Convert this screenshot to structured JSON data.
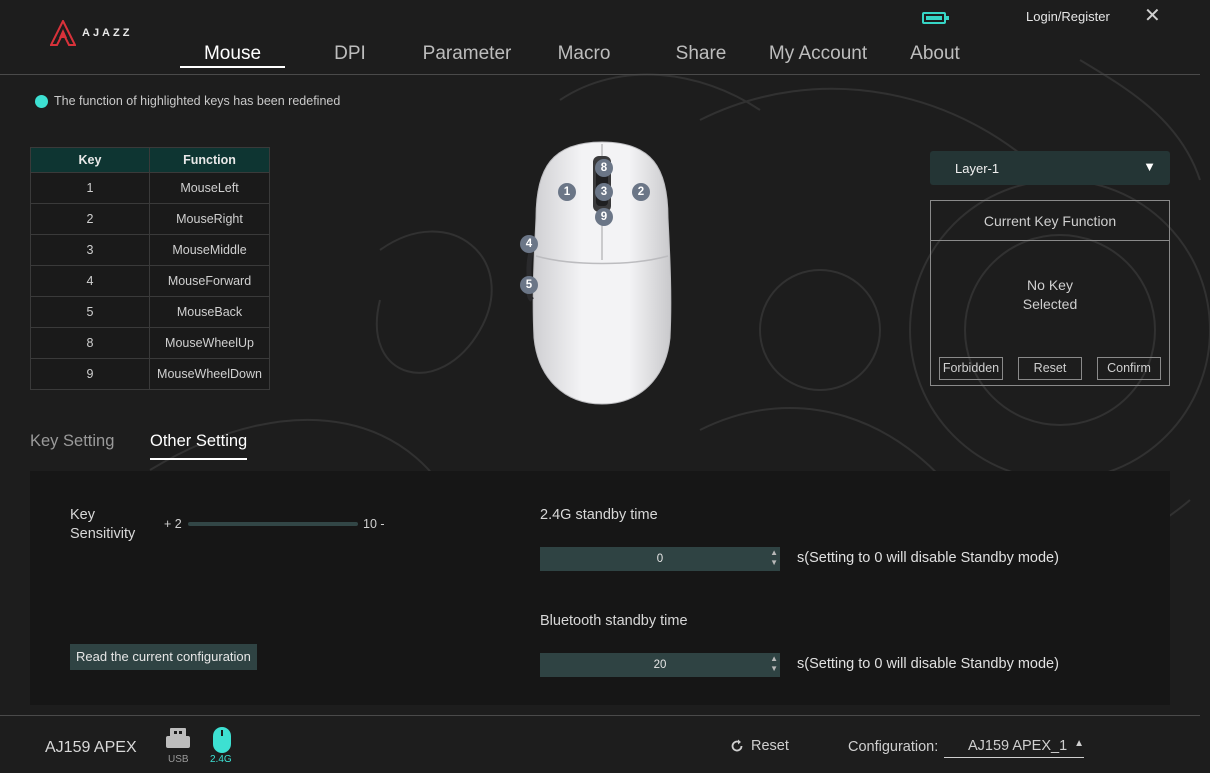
{
  "brand": {
    "logo_text": "AJAZZ"
  },
  "header": {
    "login_label": "Login/Register",
    "tabs": [
      {
        "label": "Mouse"
      },
      {
        "label": "DPI"
      },
      {
        "label": "Parameter"
      },
      {
        "label": "Macro"
      },
      {
        "label": "Share"
      },
      {
        "label": "My Account"
      },
      {
        "label": "About"
      }
    ]
  },
  "notice": "The function of highlighted keys has been redefined",
  "key_table": {
    "headers": [
      "Key",
      "Function"
    ],
    "rows": [
      {
        "key": "1",
        "function": "MouseLeft"
      },
      {
        "key": "2",
        "function": "MouseRight"
      },
      {
        "key": "3",
        "function": "MouseMiddle"
      },
      {
        "key": "4",
        "function": "MouseForward"
      },
      {
        "key": "5",
        "function": "MouseBack"
      },
      {
        "key": "8",
        "function": "MouseWheelUp"
      },
      {
        "key": "9",
        "function": "MouseWheelDown"
      }
    ]
  },
  "mouse_markers": [
    "8",
    "1",
    "3",
    "2",
    "9",
    "4",
    "5"
  ],
  "right_panel": {
    "layer": "Layer-1",
    "current_key_title": "Current Key Function",
    "no_key_line1": "No Key",
    "no_key_line2": "Selected",
    "buttons": {
      "forbidden": "Forbidden",
      "reset": "Reset",
      "confirm": "Confirm"
    }
  },
  "sub_tabs": {
    "key_setting": "Key Setting",
    "other_setting": "Other Setting"
  },
  "settings": {
    "key_sensitivity_line1": "Key",
    "key_sensitivity_line2": "Sensitivity",
    "slider_min": "+ 2",
    "slider_max": "10 -",
    "read_button": "Read the current configuration",
    "standby_24g_label": "2.4G standby time",
    "standby_24g_value": "0",
    "bt_standby_label": "Bluetooth standby time",
    "bt_standby_value": "20",
    "hint": "s(Setting to 0 will disable Standby mode)"
  },
  "footer": {
    "device_name": "AJ159 APEX",
    "usb_label": "USB",
    "g24_label": "2.4G",
    "reset_label": "Reset",
    "config_label": "Configuration:",
    "config_value": "AJ159 APEX_1"
  },
  "colors": {
    "accent": "#3de0d2",
    "panel": "#2f4343",
    "table_header": "#0e3532"
  },
  "icons": [
    "battery-icon",
    "close-icon",
    "usb-icon",
    "wireless-mouse-icon",
    "reset-icon",
    "chevron-down-icon",
    "chevron-up-icon"
  ]
}
